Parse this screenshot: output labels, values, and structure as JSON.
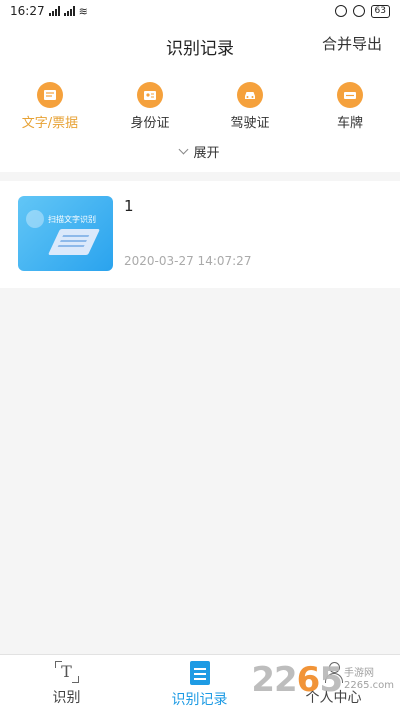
{
  "status_bar": {
    "time": "16:27",
    "battery": "63"
  },
  "header": {
    "title": "识别记录",
    "action": "合并导出"
  },
  "categories": [
    {
      "label": "文字/票据",
      "icon": "ticket-icon"
    },
    {
      "label": "身份证",
      "icon": "id-card-icon"
    },
    {
      "label": "驾驶证",
      "icon": "car-icon"
    },
    {
      "label": "车牌",
      "icon": "license-plate-icon"
    }
  ],
  "expand_label": "展开",
  "records": [
    {
      "name": "1",
      "timestamp": "2020-03-27 14:07:27",
      "thumbnail_text": "扫描文字识别"
    }
  ],
  "tabs": [
    {
      "label": "识别",
      "icon": "scan-text-icon"
    },
    {
      "label": "识别记录",
      "icon": "records-icon"
    },
    {
      "label": "个人中心",
      "icon": "person-icon"
    }
  ],
  "watermark": {
    "number": "2265",
    "text_line1": "手游网",
    "text_line2": "2265.com"
  },
  "colors": {
    "accent_orange": "#f5a13c",
    "active_blue": "#1e9be4",
    "active_category_text": "#e7a235"
  }
}
